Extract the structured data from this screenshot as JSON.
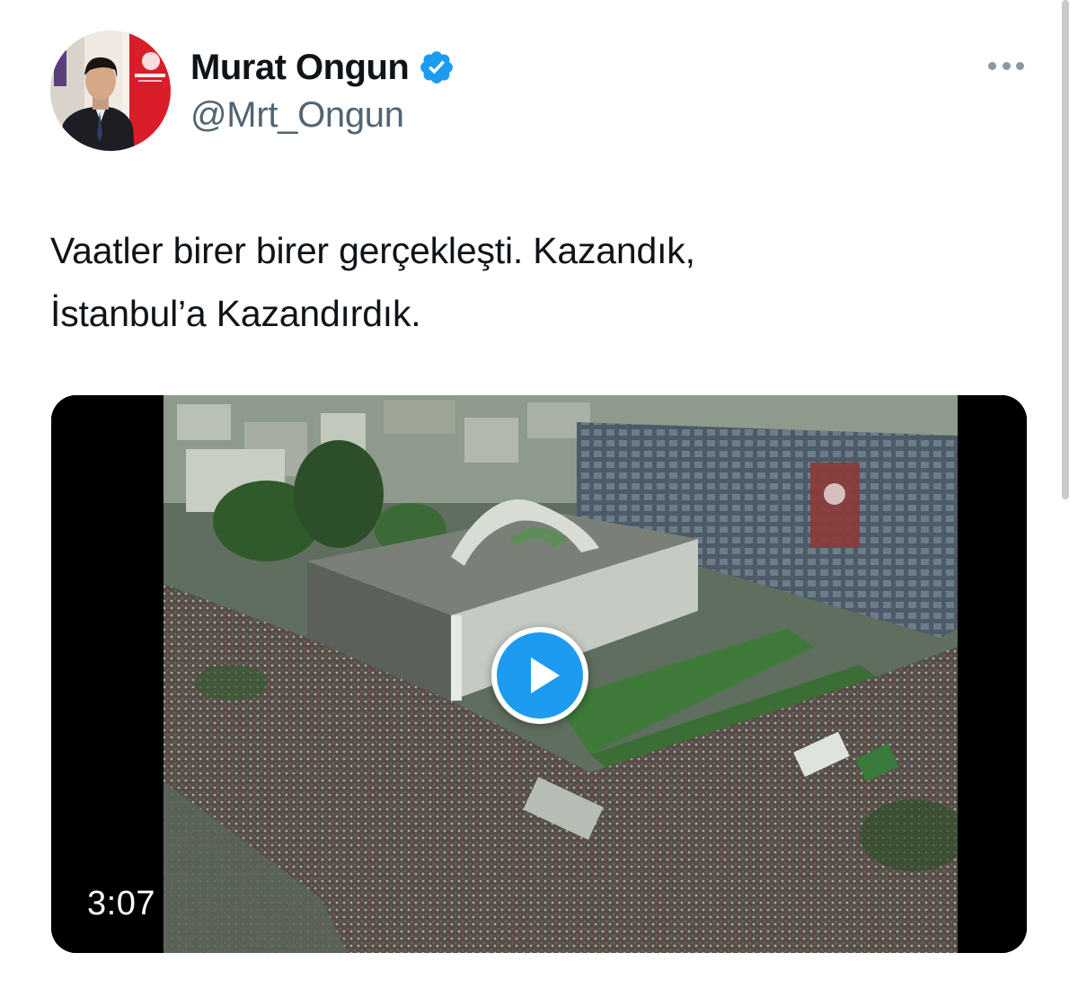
{
  "author": {
    "display_name": "Murat Ongun",
    "handle": "@Mrt_Ongun",
    "verified": true,
    "verified_badge_color": "#1d9bf0"
  },
  "tweet": {
    "text_lines": [
      "Vaatler birer birer gerçekleşti. Kazandık,",
      "İstanbul’a Kazandırdık."
    ]
  },
  "media": {
    "type": "video",
    "duration": "3:07",
    "play_icon": "play-icon",
    "accent": "#1d9bf0"
  },
  "menu": {
    "icon": "more-options-icon"
  }
}
